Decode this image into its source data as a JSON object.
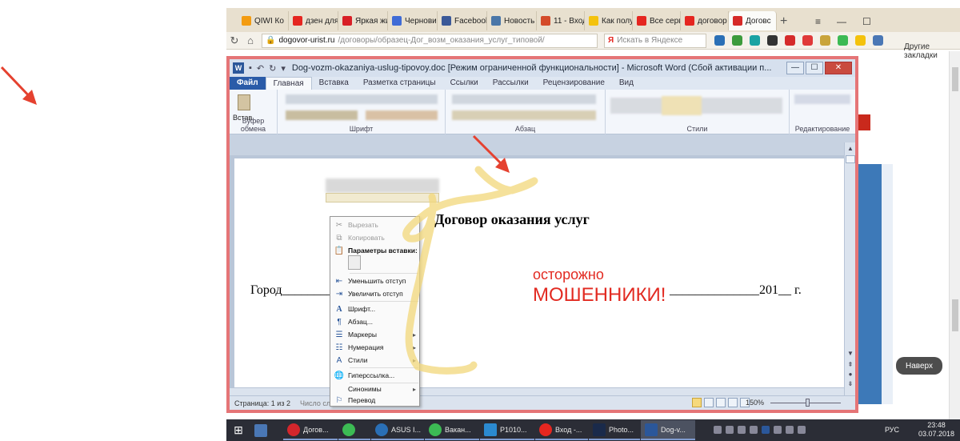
{
  "browser": {
    "tabs": [
      {
        "label": "QIWI Ко",
        "color": "#f39b10"
      },
      {
        "label": "дзен для",
        "color": "#e52620"
      },
      {
        "label": "Яркая жи",
        "color": "#d81f26"
      },
      {
        "label": "Черновик",
        "color": "#3f6bd6"
      },
      {
        "label": "Facebook",
        "color": "#3b5998"
      },
      {
        "label": "Новость",
        "color": "#4a76a8"
      },
      {
        "label": "11 - Вход",
        "color": "#d44b2a"
      },
      {
        "label": "Как полу",
        "color": "#f4c20d"
      },
      {
        "label": "Все серв",
        "color": "#e52620"
      },
      {
        "label": "договор",
        "color": "#e52620"
      },
      {
        "label": "Договс",
        "color": "#d62a28"
      }
    ],
    "url_host": "dogovor-urist.ru",
    "url_path": "/договоры/образец-Дог_возм_оказания_услуг_типовой/",
    "search_placeholder": "Искать в Яндексе",
    "bookmarks_label": "Другие закладки",
    "naverh_label": "Наверх"
  },
  "word": {
    "title": "Dog-vozm-okazaniya-uslug-tipovoy.doc [Режим ограниченной функциональности] - Microsoft Word (Сбой активации п...",
    "tabs": [
      "Файл",
      "Главная",
      "Вставка",
      "Разметка страницы",
      "Ссылки",
      "Рассылки",
      "Рецензирование",
      "Вид"
    ],
    "groups": [
      "Буфер обмена",
      "Шрифт",
      "Абзац",
      "Стили",
      "Редактирование"
    ],
    "paste_label": "Встав",
    "doc_title": "Договор оказания услуг",
    "doc_city": "Город_____________",
    "doc_date": "______________201__ г.",
    "warning_line1": "осторожно",
    "warning_line2": "МОШЕННИКИ!",
    "status_page": "Страница: 1 из 2",
    "status_words": "Число слов",
    "zoom": "150%"
  },
  "context_menu": {
    "items": [
      {
        "label": "Вырезать",
        "icon": "scissors-icon",
        "disabled": true
      },
      {
        "label": "Копировать",
        "icon": "copy-icon",
        "disabled": true
      },
      {
        "label": "Параметры вставки:",
        "icon": "paste-icon",
        "header": true
      },
      {
        "label": "Уменьшить отступ",
        "icon": "outdent-icon"
      },
      {
        "label": "Увеличить отступ",
        "icon": "indent-icon"
      },
      {
        "label": "Шрифт...",
        "icon": "font-icon"
      },
      {
        "label": "Абзац...",
        "icon": "paragraph-icon"
      },
      {
        "label": "Маркеры",
        "icon": "bullets-icon",
        "submenu": true
      },
      {
        "label": "Нумерация",
        "icon": "numbering-icon",
        "submenu": true
      },
      {
        "label": "Стили",
        "icon": "styles-icon",
        "submenu": true
      },
      {
        "label": "Гиперссылка...",
        "icon": "hyperlink-icon"
      },
      {
        "label": "Синонимы",
        "icon": "",
        "submenu": true
      },
      {
        "label": "Перевод",
        "icon": "translate-icon"
      }
    ]
  },
  "taskbar": {
    "items": [
      {
        "label": "",
        "color": "#4a77b5"
      },
      {
        "label": "Догов...",
        "color": "#d4262c"
      },
      {
        "label": "",
        "color": "#3cba54"
      },
      {
        "label": "ASUS I...",
        "color": "#2a6fb6"
      },
      {
        "label": "Вакан...",
        "color": "#3cba54"
      },
      {
        "label": "P1010...",
        "color": "#2b8ad0"
      },
      {
        "label": "Вход -...",
        "color": "#e52620"
      },
      {
        "label": "Photo...",
        "color": "#1a2a4a"
      },
      {
        "label": "Dog-v...",
        "color": "#2b579a"
      }
    ],
    "language": "РУС",
    "time": "23:48",
    "date": "03.07.2018"
  },
  "colors": {
    "accent_red": "#e22a21",
    "word_blue": "#2b579a",
    "doodle_yellow": "#f2d77a"
  }
}
